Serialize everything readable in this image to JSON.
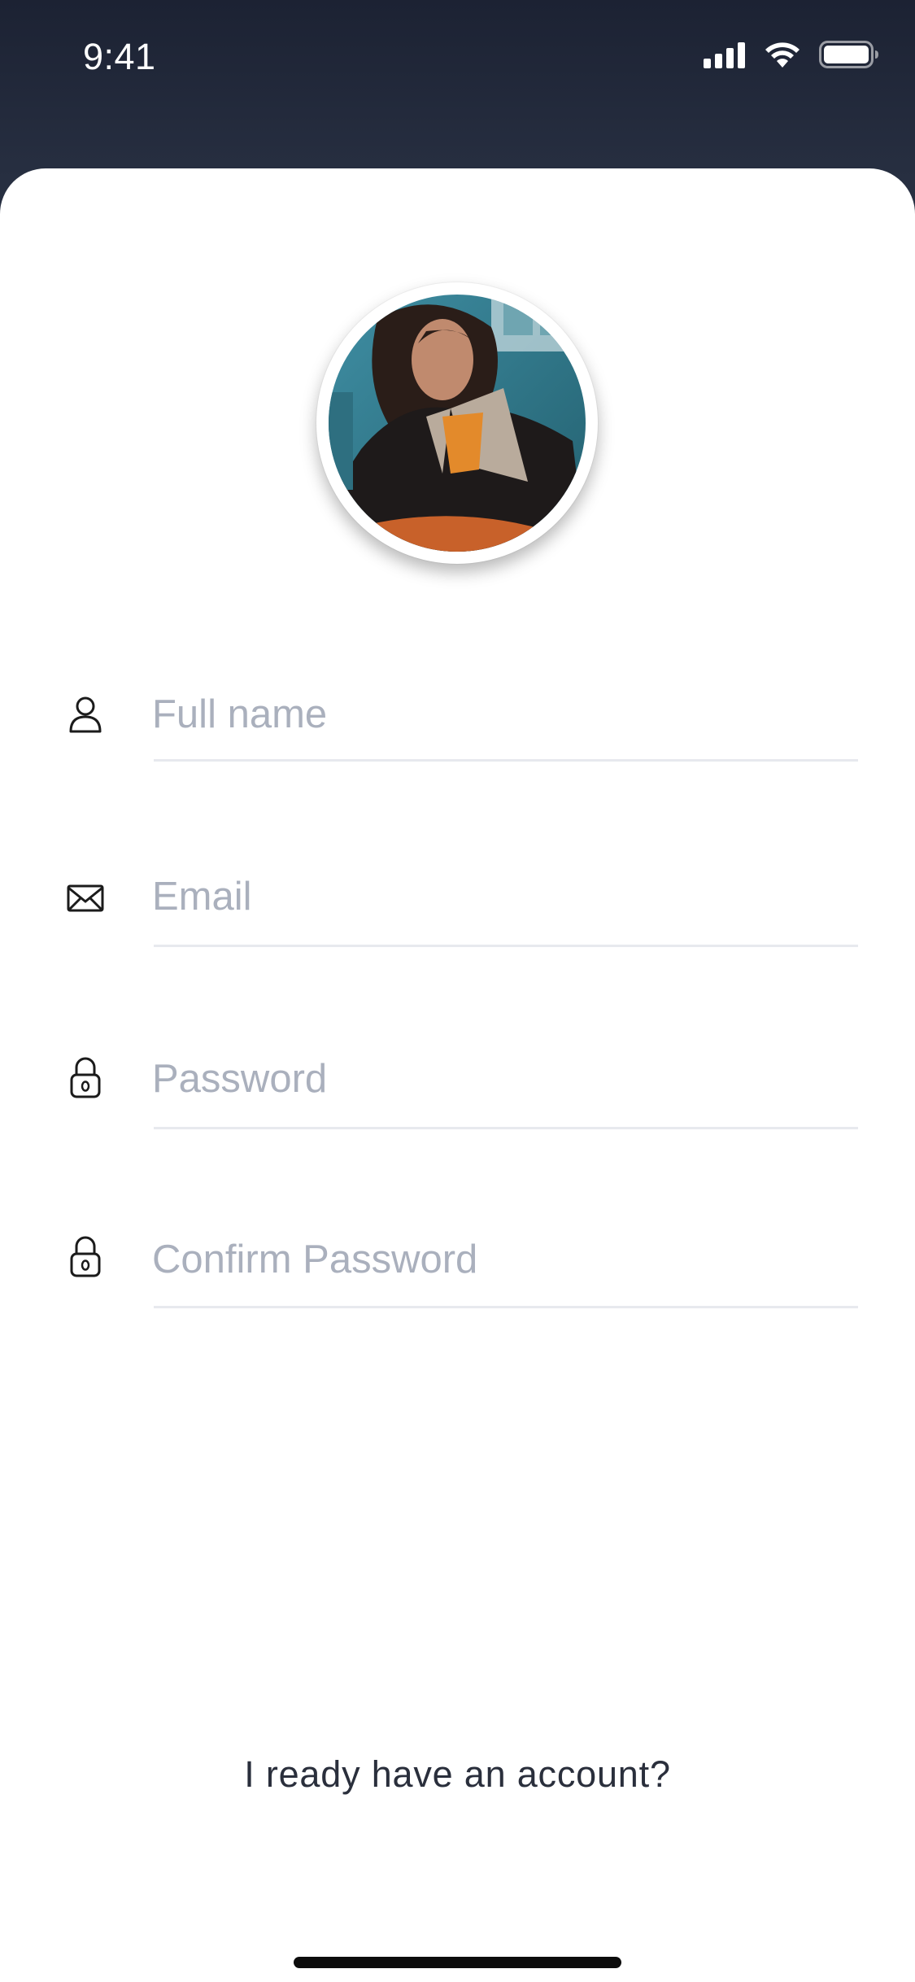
{
  "status_bar": {
    "time": "9:41"
  },
  "avatar": {
    "icon": "profile-photo"
  },
  "form": {
    "full_name": {
      "placeholder": "Full name",
      "value": "",
      "icon": "user-icon"
    },
    "email": {
      "placeholder": "Email",
      "value": "",
      "icon": "envelope-icon"
    },
    "password": {
      "placeholder": "Password",
      "value": "",
      "icon": "lock-icon"
    },
    "confirm_password": {
      "placeholder": "Confirm Password",
      "value": "",
      "icon": "lock-icon"
    }
  },
  "footer": {
    "account_link": "I ready have an account?"
  },
  "colors": {
    "header_bg": "#272f41",
    "card_bg": "#ffffff",
    "placeholder": "#aab0bd",
    "divider": "#e7e9ee",
    "text": "#2a2f3c"
  }
}
